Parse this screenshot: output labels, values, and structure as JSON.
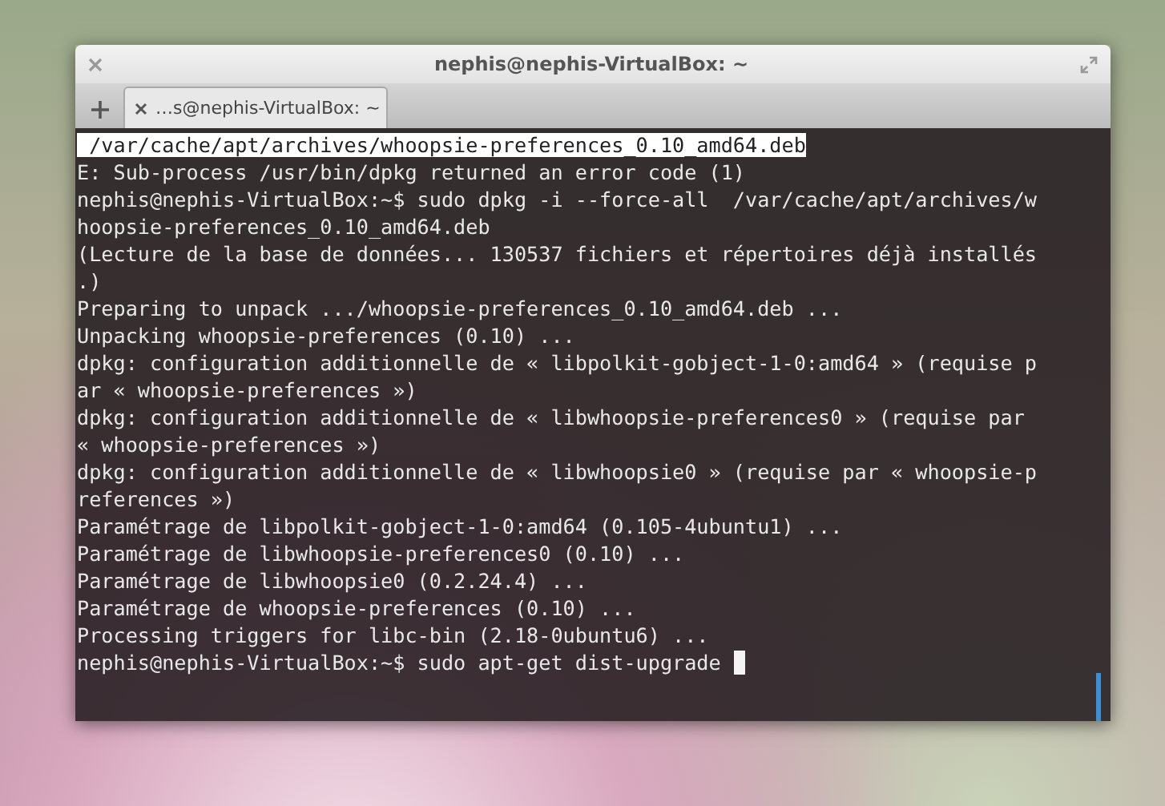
{
  "window": {
    "title": "nephis@nephis-VirtualBox: ~"
  },
  "tabs": [
    {
      "label": "…s@nephis-VirtualBox: ~",
      "selected": true
    }
  ],
  "terminal": {
    "lines": [
      {
        "text": " /var/cache/apt/archives/whoopsie-preferences_0.10_amd64.deb",
        "highlighted": true,
        "cursor": false
      },
      {
        "text": "E: Sub-process /usr/bin/dpkg returned an error code (1)",
        "highlighted": false,
        "cursor": false
      },
      {
        "text": "nephis@nephis-VirtualBox:~$ sudo dpkg -i --force-all  /var/cache/apt/archives/w",
        "highlighted": false,
        "cursor": false
      },
      {
        "text": "hoopsie-preferences_0.10_amd64.deb",
        "highlighted": false,
        "cursor": false
      },
      {
        "text": "(Lecture de la base de données... 130537 fichiers et répertoires déjà installés",
        "highlighted": false,
        "cursor": false
      },
      {
        "text": ".)",
        "highlighted": false,
        "cursor": false
      },
      {
        "text": "Preparing to unpack .../whoopsie-preferences_0.10_amd64.deb ...",
        "highlighted": false,
        "cursor": false
      },
      {
        "text": "Unpacking whoopsie-preferences (0.10) ...",
        "highlighted": false,
        "cursor": false
      },
      {
        "text": "dpkg: configuration additionnelle de « libpolkit-gobject-1-0:amd64 » (requise p",
        "highlighted": false,
        "cursor": false
      },
      {
        "text": "ar « whoopsie-preferences »)",
        "highlighted": false,
        "cursor": false
      },
      {
        "text": "dpkg: configuration additionnelle de « libwhoopsie-preferences0 » (requise par",
        "highlighted": false,
        "cursor": false
      },
      {
        "text": "« whoopsie-preferences »)",
        "highlighted": false,
        "cursor": false
      },
      {
        "text": "dpkg: configuration additionnelle de « libwhoopsie0 » (requise par « whoopsie-p",
        "highlighted": false,
        "cursor": false
      },
      {
        "text": "references »)",
        "highlighted": false,
        "cursor": false
      },
      {
        "text": "Paramétrage de libpolkit-gobject-1-0:amd64 (0.105-4ubuntu1) ...",
        "highlighted": false,
        "cursor": false
      },
      {
        "text": "Paramétrage de libwhoopsie-preferences0 (0.10) ...",
        "highlighted": false,
        "cursor": false
      },
      {
        "text": "Paramétrage de libwhoopsie0 (0.2.24.4) ...",
        "highlighted": false,
        "cursor": false
      },
      {
        "text": "Paramétrage de whoopsie-preferences (0.10) ...",
        "highlighted": false,
        "cursor": false
      },
      {
        "text": "Processing triggers for libc-bin (2.18-0ubuntu6) ...",
        "highlighted": false,
        "cursor": false
      },
      {
        "text": "nephis@nephis-VirtualBox:~$ sudo apt-get dist-upgrade",
        "highlighted": false,
        "cursor": true
      }
    ]
  }
}
